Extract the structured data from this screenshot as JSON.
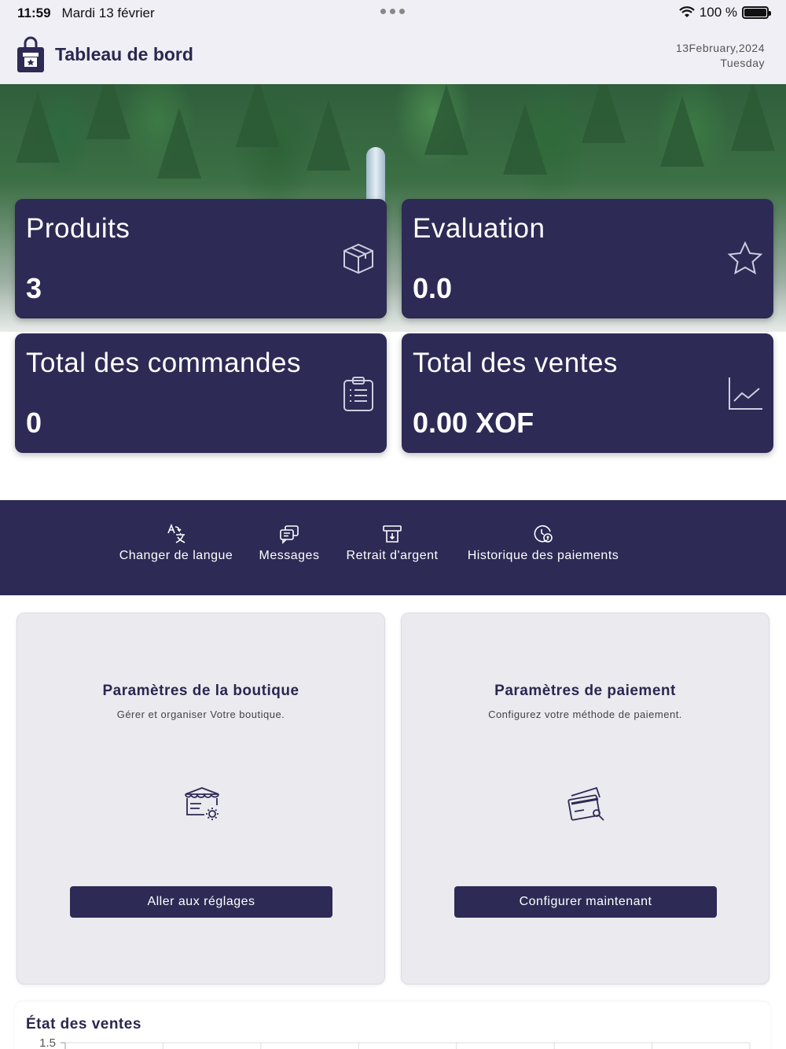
{
  "status_bar": {
    "time": "11:59",
    "date": "Mardi 13 février",
    "battery": "100 %"
  },
  "header": {
    "title": "Tableau de bord",
    "date": "13February,2024",
    "weekday": "Tuesday"
  },
  "stats": [
    {
      "label": "Produits",
      "value": "3",
      "icon": "box-icon"
    },
    {
      "label": "Evaluation",
      "value": "0.0",
      "icon": "star-icon"
    },
    {
      "label": "Total des commandes",
      "value": "0",
      "icon": "clipboard-list-icon"
    },
    {
      "label": "Total des ventes",
      "value": "0.00 XOF",
      "icon": "line-chart-icon"
    }
  ],
  "nav": [
    {
      "label": "Changer de langue",
      "icon": "translate-icon"
    },
    {
      "label": "Messages",
      "icon": "chat-icon"
    },
    {
      "label": "Retrait d'argent",
      "icon": "withdraw-icon"
    },
    {
      "label": "Historique des paiements",
      "icon": "payment-history-icon"
    }
  ],
  "settings": [
    {
      "title": "Paramètres de la boutique",
      "subtitle": "Gérer et organiser Votre boutique.",
      "button": "Aller aux réglages",
      "icon": "shop-settings-icon"
    },
    {
      "title": "Paramètres de paiement",
      "subtitle": "Configurez votre méthode de paiement.",
      "button": "Configurer maintenant",
      "icon": "card-settings-icon"
    }
  ],
  "chart_data": {
    "type": "bar",
    "title": "État des ventes",
    "y_ticks": [
      "1.5"
    ],
    "ylim": [
      0,
      1.5
    ],
    "grid": true
  },
  "colors": {
    "primary": "#2d2a55",
    "header_bg": "#efeff5",
    "card_bg": "#eaeaef"
  }
}
